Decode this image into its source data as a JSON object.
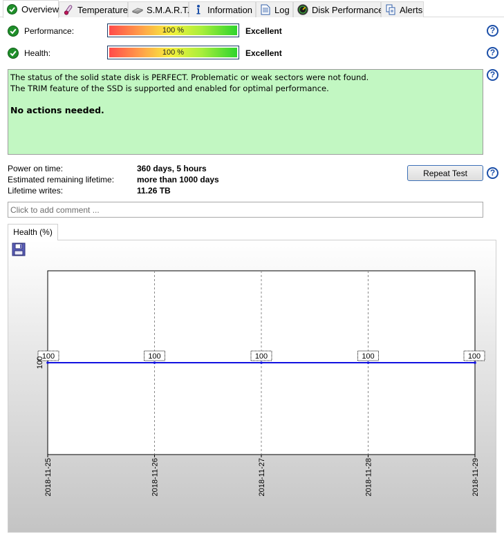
{
  "tabs": [
    {
      "label": "Overview",
      "icon": "check-icon",
      "active": true
    },
    {
      "label": "Temperature",
      "icon": "thermometer-icon",
      "active": false
    },
    {
      "label": "S.M.A.R.T.",
      "icon": "smart-icon",
      "active": false
    },
    {
      "label": "Information",
      "icon": "info-icon",
      "active": false
    },
    {
      "label": "Log",
      "icon": "log-icon",
      "active": false
    },
    {
      "label": "Disk Performance",
      "icon": "gauge-icon",
      "active": false
    },
    {
      "label": "Alerts",
      "icon": "alerts-icon",
      "active": false
    }
  ],
  "performance": {
    "label": "Performance:",
    "percent": 100,
    "percent_text": "100 %",
    "rating": "Excellent"
  },
  "health": {
    "label": "Health:",
    "percent": 100,
    "percent_text": "100 %",
    "rating": "Excellent"
  },
  "status_message": {
    "line1": "The status of the solid state disk is PERFECT. Problematic or weak sectors were not found.",
    "line2": "The TRIM feature of the SSD is supported and enabled for optimal performance.",
    "action": "No actions needed.",
    "background_color": "#c2f7c2"
  },
  "stats": {
    "power_on_label": "Power on time:",
    "power_on_value": "360 days, 5 hours",
    "remaining_label": "Estimated remaining lifetime:",
    "remaining_value": "more than 1000 days",
    "writes_label": "Lifetime writes:",
    "writes_value": "11.26 TB"
  },
  "repeat_test_label": "Repeat Test",
  "help_label": "?",
  "comment": {
    "placeholder": "Click to add comment ...",
    "value": ""
  },
  "chart_tab_label": "Health (%)",
  "chart_data": {
    "type": "line",
    "title": "",
    "xlabel": "",
    "ylabel": "",
    "x": [
      "2018-11-25",
      "2018-11-26",
      "2018-11-27",
      "2018-11-28",
      "2018-11-29"
    ],
    "series": [
      {
        "values": [
          100,
          100,
          100,
          100,
          100
        ],
        "color": "#1010e0"
      }
    ],
    "y_ticks": [
      "100"
    ],
    "data_labels": [
      "100",
      "100",
      "100",
      "100",
      "100"
    ],
    "grid": "vertical dashed",
    "legend": "none"
  }
}
